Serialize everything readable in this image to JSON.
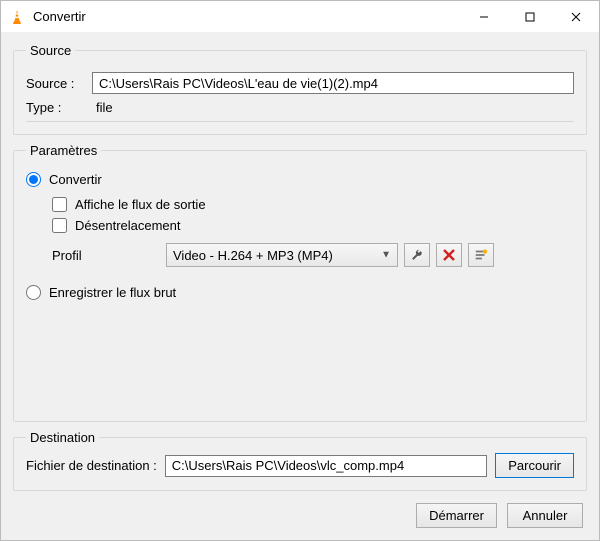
{
  "window": {
    "title": "Convertir"
  },
  "source": {
    "legend": "Source",
    "source_label": "Source :",
    "source_value": "C:\\Users\\Rais PC\\Videos\\L'eau de vie(1)(2).mp4",
    "type_label": "Type :",
    "type_value": "file"
  },
  "params": {
    "legend": "Paramètres",
    "convert_label": "Convertir",
    "display_output_label": "Affiche le flux de sortie",
    "deinterlace_label": "Désentrelacement",
    "profile_label": "Profil",
    "profile_selected": "Video - H.264 + MP3 (MP4)",
    "dump_raw_label": "Enregistrer le flux brut"
  },
  "destination": {
    "legend": "Destination",
    "file_label": "Fichier de destination :",
    "file_value": "C:\\Users\\Rais PC\\Videos\\vlc_comp.mp4",
    "browse_label": "Parcourir"
  },
  "footer": {
    "start_label": "Démarrer",
    "cancel_label": "Annuler"
  }
}
